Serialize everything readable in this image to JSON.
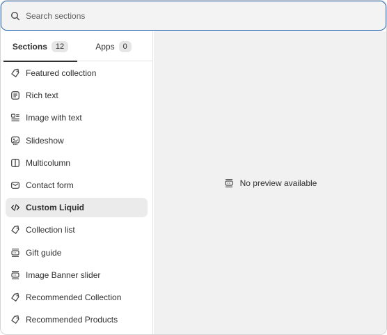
{
  "search": {
    "placeholder": "Search sections",
    "value": ""
  },
  "tabs": [
    {
      "label": "Sections",
      "count": "12",
      "active": true
    },
    {
      "label": "Apps",
      "count": "0",
      "active": false
    }
  ],
  "sections": [
    {
      "label": "Featured collection",
      "icon": "tag-icon"
    },
    {
      "label": "Rich text",
      "icon": "text-block-icon"
    },
    {
      "label": "Image with text",
      "icon": "image-with-text-icon"
    },
    {
      "label": "Slideshow",
      "icon": "slideshow-icon"
    },
    {
      "label": "Multicolumn",
      "icon": "columns-icon"
    },
    {
      "label": "Contact form",
      "icon": "email-icon"
    },
    {
      "label": "Custom Liquid",
      "icon": "code-icon",
      "selected": true
    },
    {
      "label": "Collection list",
      "icon": "tag-icon"
    },
    {
      "label": "Gift guide",
      "icon": "layout-section-icon"
    },
    {
      "label": "Image Banner slider",
      "icon": "layout-section-icon"
    },
    {
      "label": "Recommended Collection",
      "icon": "tag-icon"
    },
    {
      "label": "Recommended Products",
      "icon": "tag-icon"
    }
  ],
  "preview": {
    "message": "No preview available",
    "icon": "layout-section-icon"
  }
}
